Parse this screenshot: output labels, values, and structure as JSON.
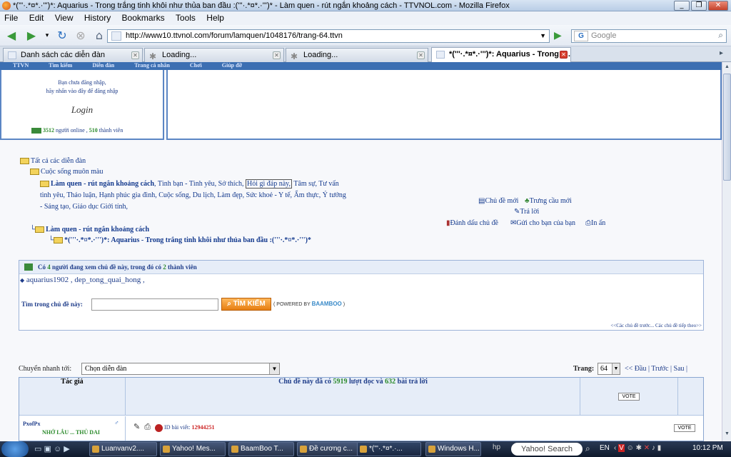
{
  "window": {
    "title": "*('''·.*¤*.·''')*: Aquarius - Trong trắng tinh khôi như thủa ban đầu :('''·.*¤*.·''')* - Làm quen - rút ngắn khoảng cách - TTVNOL.com - Mozilla Firefox"
  },
  "menu": [
    "File",
    "Edit",
    "View",
    "History",
    "Bookmarks",
    "Tools",
    "Help"
  ],
  "url": "http://www10.ttvnol.com/forum/lamquen/1048176/trang-64.ttvn",
  "search_placeholder": "Google",
  "tabs": [
    {
      "label": "Danh sách các diễn đàn"
    },
    {
      "label": "Loading..."
    },
    {
      "label": "Loading..."
    },
    {
      "label": "*('''·.*¤*.·''')*: Aquarius - Trong t..."
    }
  ],
  "forum_nav": [
    "TTVN",
    "Tìm kiếm",
    "Diễn đàn",
    "Trang cá nhân",
    "Chơi",
    "Giúp đỡ"
  ],
  "login": {
    "line1": "Bạn chưa đăng nhập,",
    "line2": "hãy nhấn vào đây để đăng nhập",
    "button": "Login",
    "online_count": "3512",
    "online_text": "người online ,",
    "member_count": "510",
    "member_text": "thành viên"
  },
  "breadcrumb": {
    "all": "Tất cả các diễn đàn",
    "life": "Cuộc sống muôn màu",
    "lamquen_bold": "Làm quen - rút ngắn khoảng cách",
    "subforums": [
      ", Tình bạn - Tình yêu,",
      "Sở thích,",
      "Hỏi gì đáp này,",
      "Tâm sự,",
      "Tư vấn tình yêu,",
      "Thảo luận,",
      "Hạnh phúc gia đình,",
      "Cuộc sống,",
      "Du lịch,",
      "Làm đẹp,",
      "Sức khoẻ - Y tế,",
      "Ẩm thực,",
      "Ý tưởng - Sáng tạo,",
      "Giáo dục Giới tính,"
    ],
    "lamquen2": "Làm quen - rút ngắn khoảng cách",
    "topic": "*('''·.*¤*.·''')*: Aquarius - Trong trắng tinh khôi như thủa ban đầu :('''·.*¤*.·''')*"
  },
  "actions": {
    "new_topic": "Chủ đề mới",
    "poll": "Trưng cầu mới",
    "reply": "Trả lời",
    "mark": "Đánh dấu chủ đề",
    "send": "Gửi cho bạn của bạn",
    "print": "In ấn"
  },
  "viewers": {
    "prefix": "Có",
    "count": "4",
    "middle": "người đang xem chủ đề này, trong đó có",
    "members": "2",
    "suffix": "thành viên",
    "list": "aquarius1902 , dep_tong_quai_hong ,"
  },
  "topic_search": {
    "label": "Tìm trong chủ đề này:",
    "button": "TÌM KIẾM",
    "powered": "POWERED BY",
    "brand": "BAAMBOO"
  },
  "prevnext": "<<Các chủ đề trước... Các chủ đề tiếp theo>>",
  "quickjump": {
    "label": "Chuyển nhanh tới:",
    "value": "Chọn diễn đàn"
  },
  "paging": {
    "label": "Trang:",
    "value": "64",
    "first": "<< Đầu",
    "prev": "Trước",
    "next": "Sau"
  },
  "thread_header": {
    "author": "Tác giả",
    "stats_prefix": "Chủ đề này đã có",
    "views": "5919",
    "stats_mid": "lượt đọc và",
    "replies": "632",
    "stats_suffix": "bài trả lời",
    "vote": "VOTE"
  },
  "post": {
    "author": "PxofPx",
    "title": "NHỚ LẮU ... THỦ DAI",
    "id_label": "ID bài viết:",
    "id": "12944251",
    "vote": "VOTE"
  },
  "taskbar": {
    "items": [
      "Luanvanv2....",
      "Yahoo! Mes...",
      "BaamBoo T...",
      "Đề cương c...",
      "*('''·.*¤*.·...",
      "Windows H..."
    ],
    "search": "Yahoo! Search",
    "lang": "EN",
    "time": "10:12 PM"
  }
}
